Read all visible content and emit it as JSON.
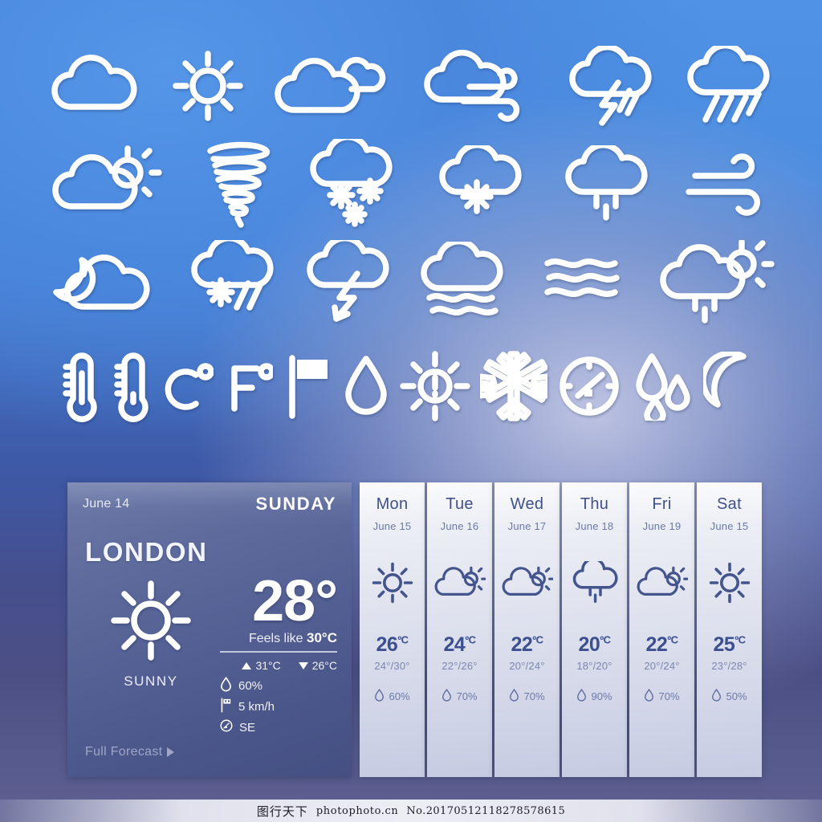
{
  "icon_sheet": {
    "rows": [
      {
        "icons": [
          {
            "name": "cloud-icon",
            "label": "Cloudy"
          },
          {
            "name": "sun-icon",
            "label": "Sunny"
          },
          {
            "name": "partly-cloudy-icon",
            "label": "Partly cloudy"
          },
          {
            "name": "windy-cloud-icon",
            "label": "Windy"
          },
          {
            "name": "thunderstorm-icon",
            "label": "Thunderstorm"
          },
          {
            "name": "heavy-rain-icon",
            "label": "Heavy rain"
          }
        ]
      },
      {
        "icons": [
          {
            "name": "cloud-sun-icon",
            "label": "Sun behind cloud"
          },
          {
            "name": "tornado-icon",
            "label": "Tornado"
          },
          {
            "name": "heavy-snow-icon",
            "label": "Heavy snow"
          },
          {
            "name": "light-snow-icon",
            "label": "Light snow"
          },
          {
            "name": "drizzle-icon",
            "label": "Drizzle"
          },
          {
            "name": "wind-icon",
            "label": "Wind"
          }
        ]
      },
      {
        "icons": [
          {
            "name": "night-cloud-icon",
            "label": "Cloudy night"
          },
          {
            "name": "sleet-icon",
            "label": "Sleet"
          },
          {
            "name": "lightning-icon",
            "label": "Lightning"
          },
          {
            "name": "cloud-fog-icon",
            "label": "Cloud with fog"
          },
          {
            "name": "fog-icon",
            "label": "Fog"
          },
          {
            "name": "sun-shower-icon",
            "label": "Sun shower"
          }
        ]
      },
      {
        "icons": [
          {
            "name": "thermometer-high-icon",
            "label": "Thermometer high"
          },
          {
            "name": "thermometer-low-icon",
            "label": "Thermometer low"
          },
          {
            "name": "celsius-icon",
            "label": "C°"
          },
          {
            "name": "fahrenheit-icon",
            "label": "F°"
          },
          {
            "name": "wind-flag-icon",
            "label": "Wind flag"
          },
          {
            "name": "droplet-icon",
            "label": "Humidity droplet"
          },
          {
            "name": "uv-index-icon",
            "label": "UV index"
          },
          {
            "name": "snowflake-icon",
            "label": "Snowflake"
          },
          {
            "name": "compass-icon",
            "label": "Compass"
          },
          {
            "name": "rain-drops-icon",
            "label": "Precipitation"
          },
          {
            "name": "moon-icon",
            "label": "Night"
          }
        ]
      }
    ]
  },
  "today": {
    "date": "June 14",
    "weekday": "SUNDAY",
    "city": "LONDON",
    "condition": "SUNNY",
    "condition_icon": "sun-icon",
    "temperature": "28°",
    "feels_like_label": "Feels like",
    "feels_like_value": "30°C",
    "high": "31°C",
    "low": "26°C",
    "humidity": "60%",
    "wind": "5 km/h",
    "wind_direction": "SE",
    "full_forecast_label": "Full Forecast"
  },
  "forecast": {
    "days": [
      {
        "day": "Mon",
        "date": "June 15",
        "icon": "sun-icon",
        "temp": "26",
        "unit": "ºC",
        "range": "24°/30°",
        "rain": "60%"
      },
      {
        "day": "Tue",
        "date": "June 16",
        "icon": "cloud-sun-icon",
        "temp": "24",
        "unit": "ºC",
        "range": "22°/26°",
        "rain": "70%"
      },
      {
        "day": "Wed",
        "date": "June 17",
        "icon": "cloud-sun-icon",
        "temp": "22",
        "unit": "ºC",
        "range": "20°/24°",
        "rain": "70%"
      },
      {
        "day": "Thu",
        "date": "June 18",
        "icon": "drizzle-icon",
        "temp": "20",
        "unit": "ºC",
        "range": "18°/20°",
        "rain": "90%"
      },
      {
        "day": "Fri",
        "date": "June 19",
        "icon": "cloud-sun-icon",
        "temp": "22",
        "unit": "ºC",
        "range": "20°/24°",
        "rain": "70%"
      },
      {
        "day": "Sat",
        "date": "June 15",
        "icon": "sun-icon",
        "temp": "25",
        "unit": "ºC",
        "range": "23°/28°",
        "rain": "50%"
      }
    ]
  },
  "watermark": {
    "cn": "图行天下",
    "site": "photophoto.cn",
    "number": "No.20170512118278578615"
  },
  "colors": {
    "sky_top": "#4f93e6",
    "sky_bottom": "#5e6090",
    "card_bg": "#5e6b9c",
    "panel_bg": "#e3e6f0",
    "accent_text": "#3c4f8e",
    "icon_stroke": "#ffffff"
  }
}
